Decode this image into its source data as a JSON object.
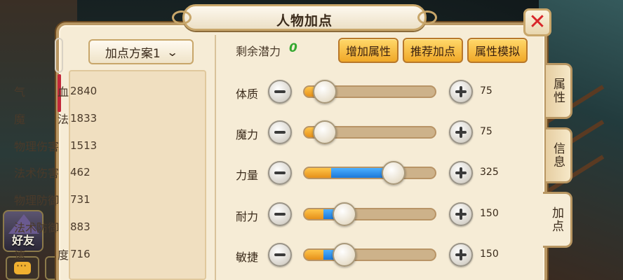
{
  "window": {
    "title": "人物加点"
  },
  "hud": {
    "friends_label": "好友"
  },
  "plan": {
    "label": "加点方案1"
  },
  "stats": [
    {
      "name": "气血",
      "value": "2840"
    },
    {
      "name": "魔法",
      "value": "1833"
    },
    {
      "name": "物理伤害",
      "value": "1513"
    },
    {
      "name": "法术伤害",
      "value": "462"
    },
    {
      "name": "物理防御",
      "value": "731"
    },
    {
      "name": "法术防御",
      "value": "883"
    },
    {
      "name": "速度",
      "value": "716"
    }
  ],
  "potential": {
    "label": "剩余潜力",
    "value": "0"
  },
  "buttons": {
    "add_attr": "增加属性",
    "recommend": "推荐加点",
    "simulate": "属性模拟"
  },
  "attributes": [
    {
      "name": "体质",
      "value": "75",
      "orange_fraction": 0.07,
      "blue_fraction": 0.0,
      "knob_fraction": 0.15
    },
    {
      "name": "魔力",
      "value": "75",
      "orange_fraction": 0.07,
      "blue_fraction": 0.0,
      "knob_fraction": 0.15
    },
    {
      "name": "力量",
      "value": "325",
      "orange_fraction": 0.2,
      "blue_fraction": 0.47,
      "knob_fraction": 0.67
    },
    {
      "name": "耐力",
      "value": "150",
      "orange_fraction": 0.14,
      "blue_fraction": 0.14,
      "knob_fraction": 0.3
    },
    {
      "name": "敏捷",
      "value": "150",
      "orange_fraction": 0.14,
      "blue_fraction": 0.14,
      "knob_fraction": 0.3
    }
  ],
  "tabs": [
    {
      "label": "属性",
      "active": false
    },
    {
      "label": "信息",
      "active": false
    },
    {
      "label": "加点",
      "active": true
    }
  ],
  "colors": {
    "panel_bg": "#f6ecd6",
    "frame": "#b89662",
    "button_gold": "#f0a828",
    "slider_orange": "#e6901a",
    "slider_blue": "#1c78d8",
    "potential_green": "#34a830",
    "close_red": "#d8262a"
  }
}
